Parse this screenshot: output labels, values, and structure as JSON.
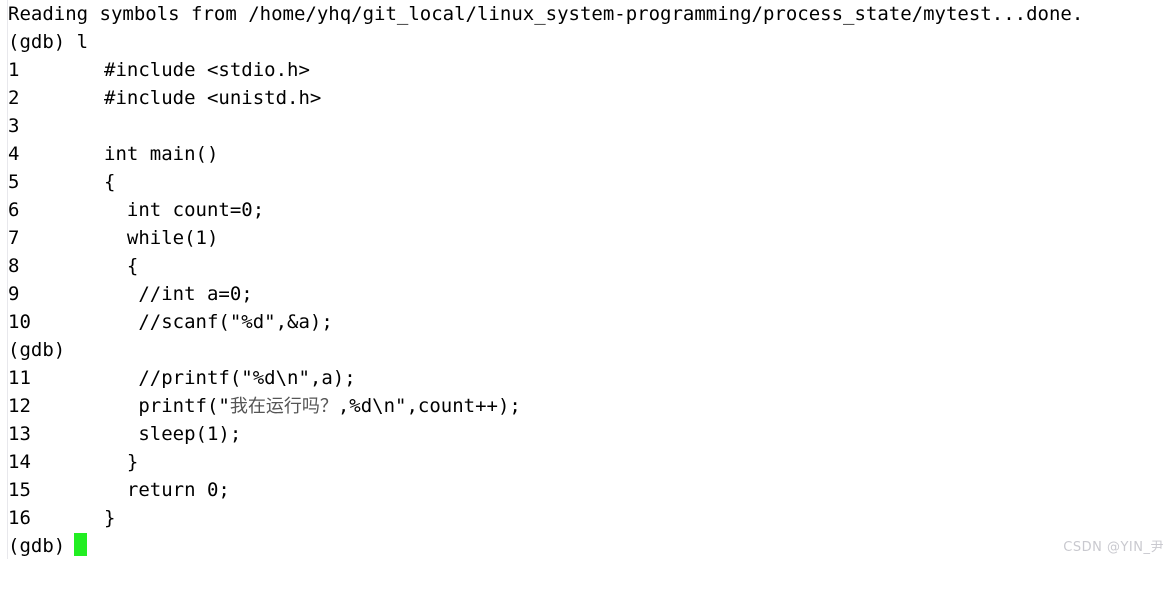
{
  "terminal": {
    "program": "gdb",
    "background_color": "#ffffff",
    "text_color": "#000000",
    "cursor_color": "#22ee22",
    "header_line": "Reading symbols from /home/yhq/git_local/linux_system-programming/process_state/mytest...done.",
    "prompt_with_command": "(gdb) l",
    "prompt_mid": "(gdb)",
    "prompt_last": "(gdb)"
  },
  "source_listing": [
    {
      "number": "1",
      "text": "#include <stdio.h>"
    },
    {
      "number": "2",
      "text": "#include <unistd.h>"
    },
    {
      "number": "3",
      "text": ""
    },
    {
      "number": "4",
      "text": "int main()"
    },
    {
      "number": "5",
      "text": "{"
    },
    {
      "number": "6",
      "text": "  int count=0;"
    },
    {
      "number": "7",
      "text": "  while(1)"
    },
    {
      "number": "8",
      "text": "  {"
    },
    {
      "number": "9",
      "text": "   //int a=0;"
    },
    {
      "number": "10",
      "text": "   //scanf(\"%d\",&a);"
    },
    {
      "number": "11",
      "text": "   //printf(\"%d\\n\",a);"
    },
    {
      "number": "12",
      "text": "   printf(\"",
      "cjk": "我在运行吗？",
      "text_after": ",%d\\n\",count++);"
    },
    {
      "number": "13",
      "text": "   sleep(1);"
    },
    {
      "number": "14",
      "text": "  }"
    },
    {
      "number": "15",
      "text": "  return 0;"
    },
    {
      "number": "16",
      "text": "}"
    }
  ],
  "watermark": {
    "label": "CSDN @YIN_尹"
  }
}
